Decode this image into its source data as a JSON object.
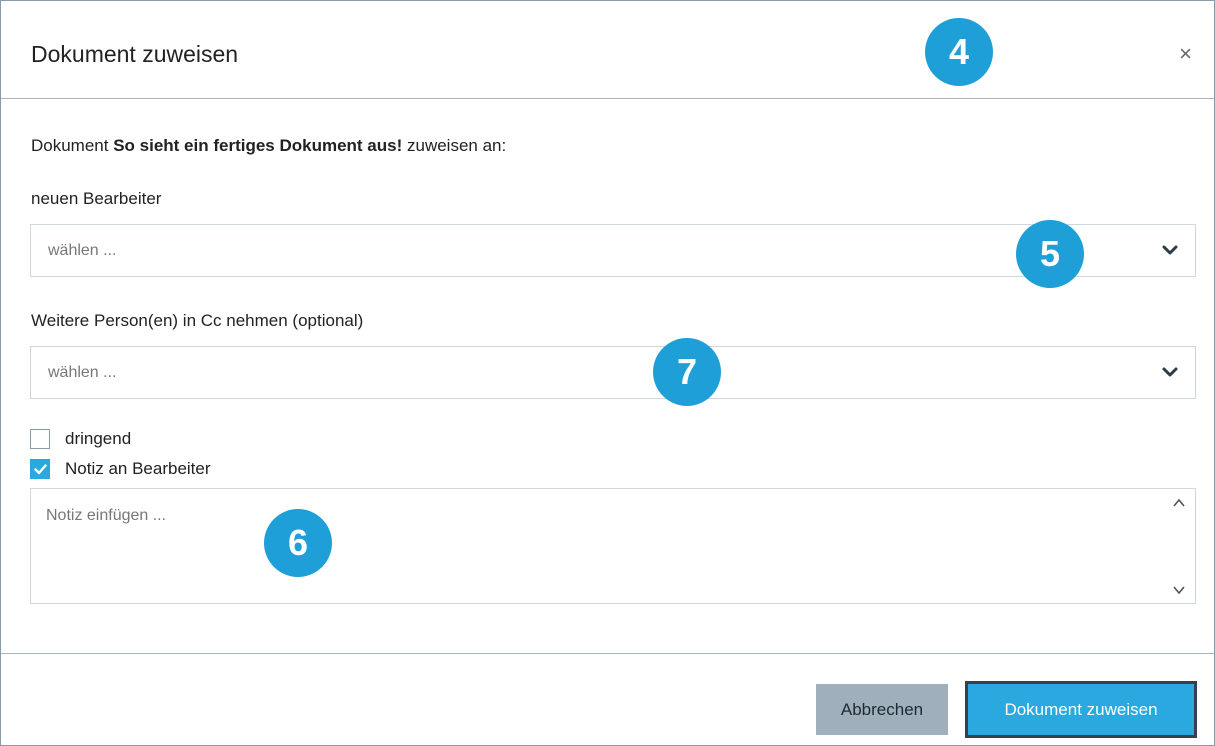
{
  "dialog": {
    "title": "Dokument zuweisen",
    "close_label": "×"
  },
  "intro": {
    "prefix": "Dokument ",
    "document_name": "So sieht ein fertiges Dokument aus!",
    "suffix": " zuweisen an:"
  },
  "assignee": {
    "label": "neuen Bearbeiter",
    "placeholder": "wählen ..."
  },
  "cc": {
    "label": "Weitere Person(en) in Cc nehmen (optional)",
    "placeholder": "wählen ..."
  },
  "options": {
    "urgent_label": "dringend",
    "urgent_checked": false,
    "note_label": "Notiz an Bearbeiter",
    "note_checked": true
  },
  "note": {
    "placeholder": "Notiz einfügen ..."
  },
  "footer": {
    "cancel_label": "Abbrechen",
    "submit_label": "Dokument zuweisen"
  },
  "callouts": {
    "header": "4",
    "assignee": "5",
    "note": "6",
    "cc": "7"
  },
  "colors": {
    "accent": "#29a9df",
    "callout": "#1e9fd8",
    "cancel_bg": "#9fafbb"
  },
  "icons": {
    "close": "close-icon",
    "dropdown": "chevron-down-icon",
    "check": "checkmark-icon",
    "scroll_up": "chevron-up-icon",
    "scroll_down": "chevron-down-icon"
  }
}
